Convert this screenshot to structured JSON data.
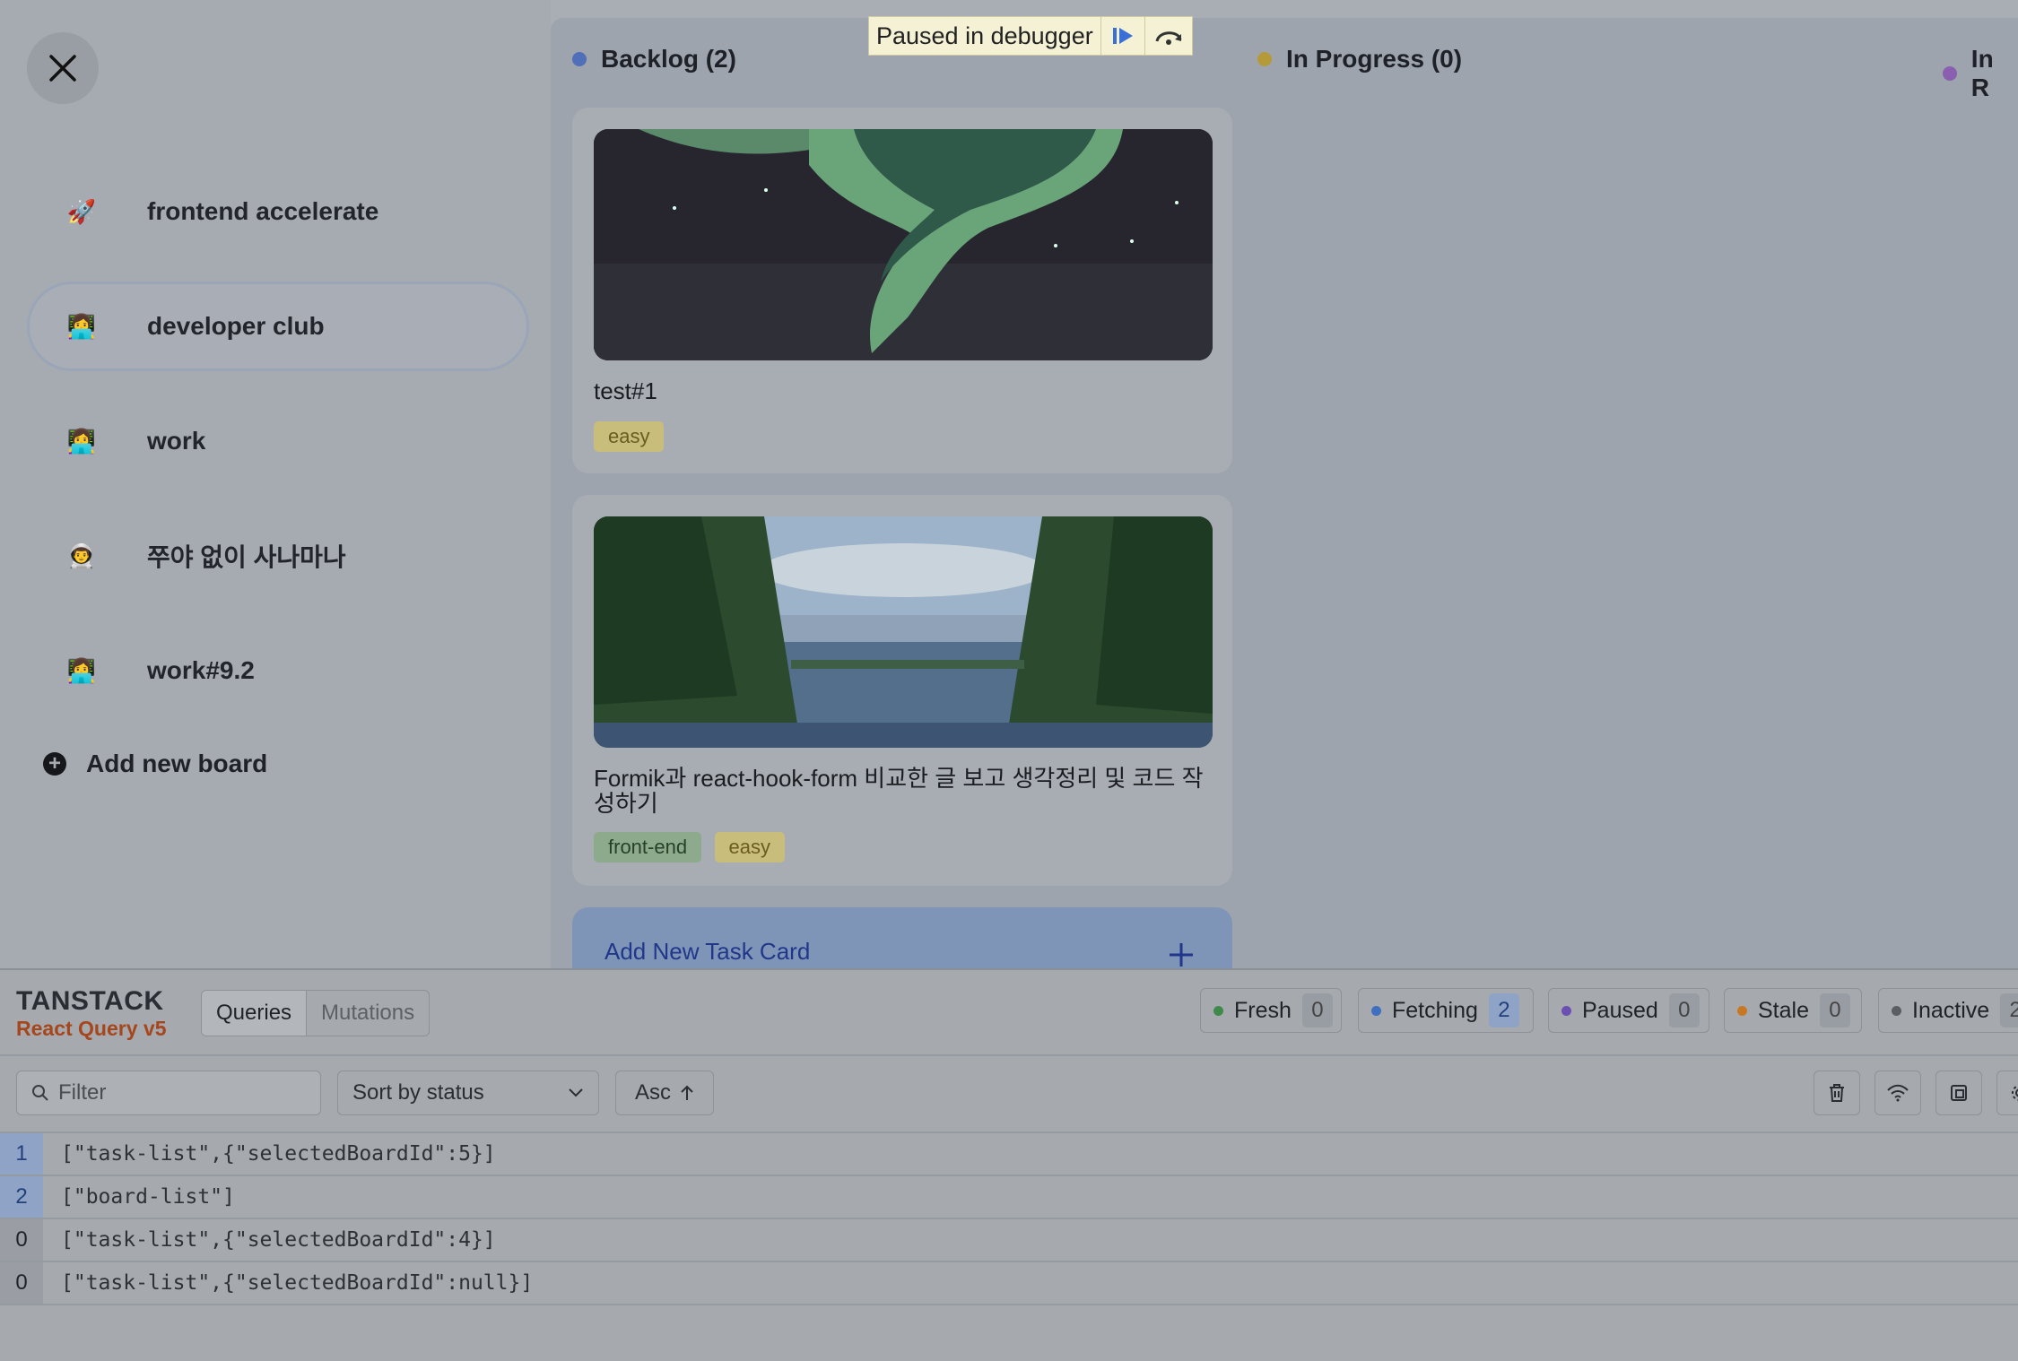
{
  "sidebar": {
    "boards": [
      {
        "emoji": "🚀",
        "name": "frontend accelerate"
      },
      {
        "emoji": "👩‍💻",
        "name": "developer club",
        "active": true
      },
      {
        "emoji": "👩‍💻",
        "name": "work"
      },
      {
        "emoji": "👨‍🚀",
        "name": "쭈야 없이 사나마나"
      },
      {
        "emoji": "👩‍💻",
        "name": "work#9.2"
      }
    ],
    "add_board_label": "Add new board"
  },
  "debugger": {
    "label": "Paused in debugger"
  },
  "columns": [
    {
      "label": "Backlog (2)",
      "color": "#4f6fb8"
    },
    {
      "label": "In Progress (0)",
      "color": "#b59a3a"
    },
    {
      "label": "In R",
      "color": "#8a5fb0"
    }
  ],
  "tasks": [
    {
      "title": "test#1",
      "tags": [
        {
          "label": "easy",
          "bg": "#c9bd7b",
          "fg": "#6b5c1f"
        }
      ]
    },
    {
      "title": "Formik과 react-hook-form 비교한 글 보고 생각정리 및 코드 작성하기",
      "tags": [
        {
          "label": "front-end",
          "bg": "#8eaa8c",
          "fg": "#27402a"
        },
        {
          "label": "easy",
          "bg": "#c9bd7b",
          "fg": "#6b5c1f"
        }
      ]
    }
  ],
  "add_task_label": "Add New Task Card",
  "devtools": {
    "brand_top": "TANSTACK",
    "brand_bottom": "React Query v5",
    "tabs": [
      "Queries",
      "Mutations"
    ],
    "status_chips": [
      {
        "label": "Fresh",
        "count": "0",
        "color": "#3f8a4b"
      },
      {
        "label": "Fetching",
        "count": "2",
        "color": "#3f6fbf"
      },
      {
        "label": "Paused",
        "count": "0",
        "color": "#6b4fb2"
      },
      {
        "label": "Stale",
        "count": "0",
        "color": "#c87822"
      },
      {
        "label": "Inactive",
        "count": "2",
        "color": "#5b5e63"
      }
    ],
    "filter_placeholder": "Filter",
    "sort_label": "Sort by status",
    "order_label": "Asc",
    "queries": [
      {
        "count": "1",
        "key": "[\"task-list\",{\"selectedBoardId\":5}]",
        "state": "fetching"
      },
      {
        "count": "2",
        "key": "[\"board-list\"]",
        "state": "fetching"
      },
      {
        "count": "0",
        "key": "[\"task-list\",{\"selectedBoardId\":4}]",
        "state": "inactive"
      },
      {
        "count": "0",
        "key": "[\"task-list\",{\"selectedBoardId\":null}]",
        "state": "inactive"
      }
    ]
  }
}
